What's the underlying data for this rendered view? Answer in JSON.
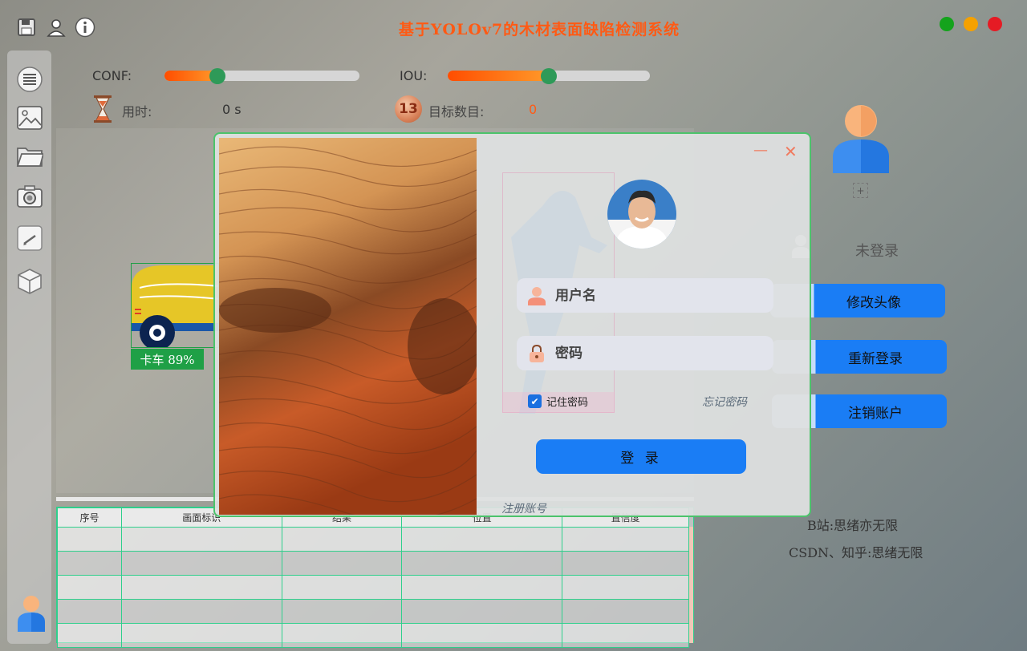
{
  "app": {
    "title": "基于YOLOv7的木材表面缺陷检测系统"
  },
  "window_controls": {
    "colors": {
      "maximize": "#14a31c",
      "minimize": "#f5a100",
      "close": "#e51b24"
    }
  },
  "sliders": {
    "conf": {
      "label": "CONF:",
      "value": 0.27
    },
    "iou": {
      "label": "IOU:",
      "value": 0.5
    }
  },
  "stats": {
    "time_label": "用时:",
    "time_value": "0 s",
    "count_label": "目标数目:",
    "count_value": "0",
    "count_badge": "13"
  },
  "left_toolbar": {
    "items": [
      "menu-icon",
      "image-icon",
      "folder-icon",
      "camera-icon",
      "video-icon",
      "model-cube-icon"
    ]
  },
  "detection": {
    "label": "卡车 89%"
  },
  "table": {
    "headers": [
      "序号",
      "画面标识",
      "结果",
      "位置",
      "置信度"
    ],
    "rows": [
      [
        "",
        "",
        "",
        "",
        ""
      ],
      [
        "",
        "",
        "",
        "",
        ""
      ],
      [
        "",
        "",
        "",
        "",
        ""
      ],
      [
        "",
        "",
        "",
        "",
        ""
      ],
      [
        "",
        "",
        "",
        "",
        ""
      ]
    ]
  },
  "right_panel": {
    "avatar_add": "+",
    "status": "未登录",
    "buttons": {
      "change_avatar": "修改头像",
      "relogin": "重新登录",
      "logout": "注销账户"
    },
    "credit_bili": "B站:思绪亦无限",
    "credit_csdn": "CSDN、知乎:思绪无限"
  },
  "login_dialog": {
    "username_placeholder": "用户名",
    "password_placeholder": "密码",
    "remember_label": "记住密码",
    "remember_checked": true,
    "forgot_link": "忘记密码",
    "login_button": "登 录",
    "register_link": "注册账号",
    "minimize_glyph": "—",
    "close_glyph": "✕"
  }
}
